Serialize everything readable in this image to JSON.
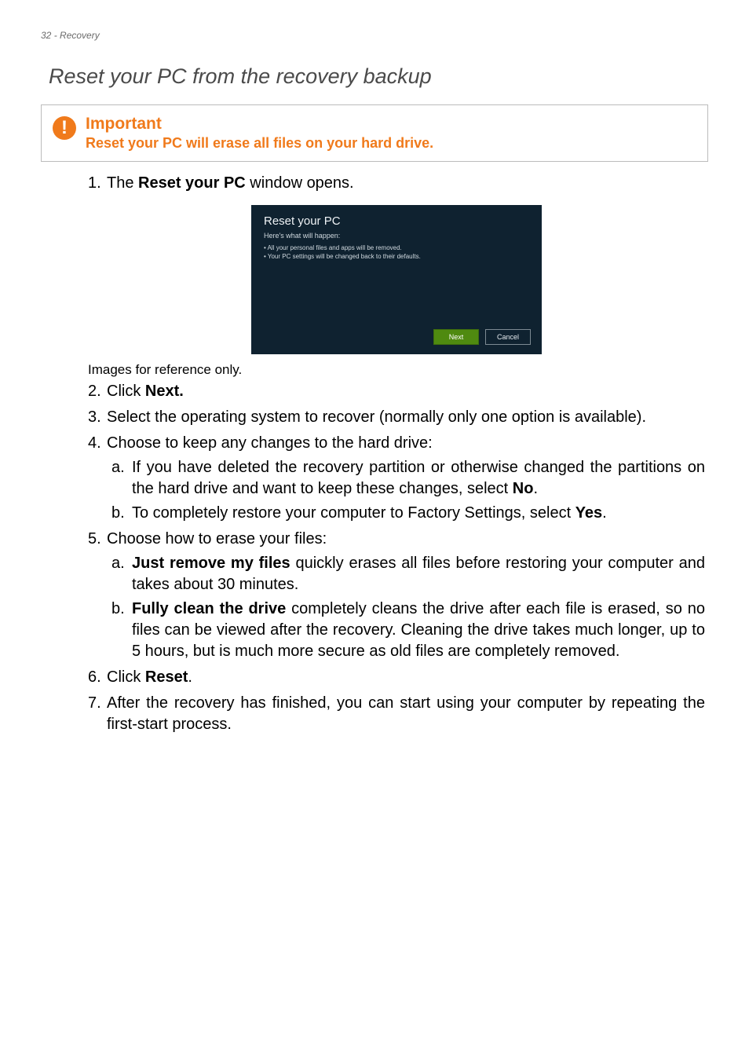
{
  "header": {
    "page_num": "32",
    "section": "Recovery"
  },
  "title": "Reset your PC from the recovery backup",
  "important": {
    "heading": "Important",
    "body": "Reset your PC will erase all files on your hard drive."
  },
  "step1": {
    "num": "1.",
    "prefix": "The ",
    "bold": "Reset your PC",
    "suffix": " window opens."
  },
  "screenshot": {
    "title": "Reset your PC",
    "subtitle": "Here's what will happen:",
    "b1": "• All your personal files and apps will be removed.",
    "b2": "• Your PC settings will be changed back to their defaults.",
    "next_label": "Next",
    "cancel_label": "Cancel"
  },
  "caption": "Images for reference only.",
  "step2": {
    "num": "2.",
    "prefix": "Click ",
    "bold": "Next."
  },
  "step3": {
    "num": "3.",
    "text": "Select the operating system to recover (normally only one option is available)."
  },
  "step4": {
    "num": "4.",
    "text": "Choose to keep any changes to the hard drive:"
  },
  "step4a": {
    "letter": "a.",
    "prefix": "If you have deleted the recovery partition or otherwise changed the partitions on the hard drive and want to keep these changes, select ",
    "bold": "No",
    "suffix": "."
  },
  "step4b": {
    "letter": "b.",
    "prefix": "To completely restore your computer to Factory Settings, select ",
    "bold": "Yes",
    "suffix": "."
  },
  "step5": {
    "num": "5.",
    "text": "Choose how to erase your files:"
  },
  "step5a": {
    "letter": "a.",
    "bold": "Just remove my files",
    "suffix": " quickly erases all files before restoring your computer and takes about 30 minutes."
  },
  "step5b": {
    "letter": "b.",
    "bold": "Fully clean the drive",
    "suffix": " completely cleans the drive after each file is erased, so no files can be viewed after the recovery. Cleaning the drive takes much longer, up to 5 hours, but is much more secure as old files are completely removed."
  },
  "step6": {
    "num": "6.",
    "prefix": "Click ",
    "bold": "Reset",
    "suffix": "."
  },
  "step7": {
    "num": "7.",
    "text": "After the recovery has finished, you can start using your computer by repeating the first-start process."
  }
}
